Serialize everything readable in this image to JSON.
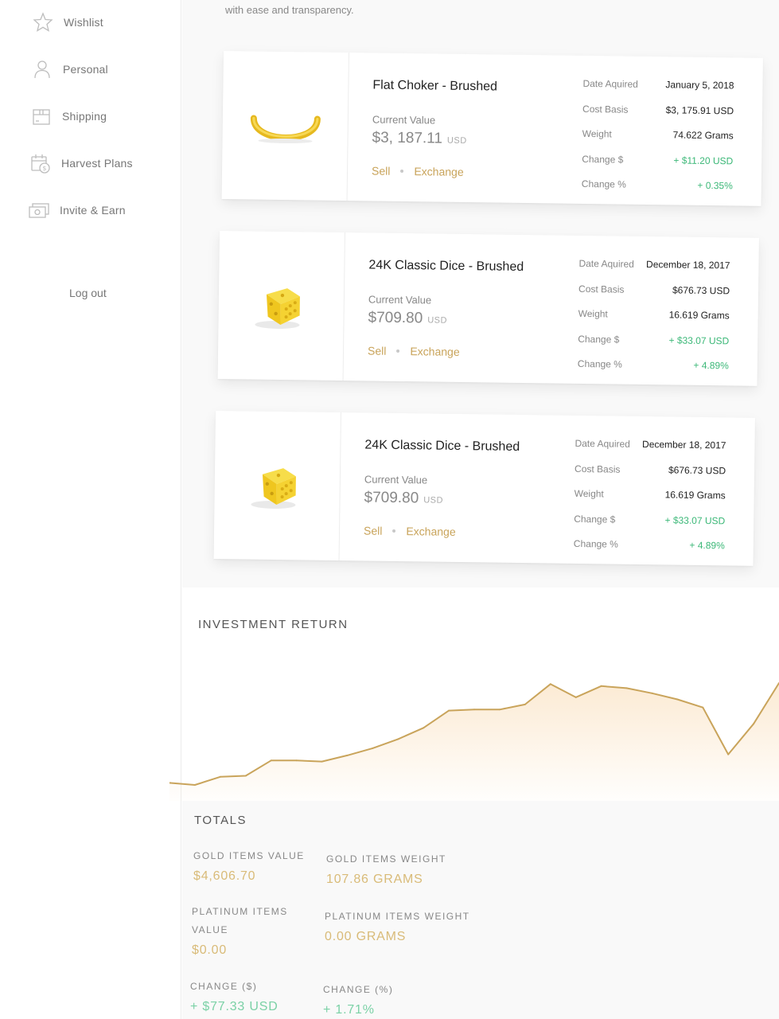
{
  "sidebar": {
    "items": [
      {
        "label": "Wishlist",
        "icon": "star-icon"
      },
      {
        "label": "Personal",
        "icon": "user-icon"
      },
      {
        "label": "Shipping",
        "icon": "package-icon"
      },
      {
        "label": "Harvest Plans",
        "icon": "calendar-dollar-icon"
      },
      {
        "label": "Invite & Earn",
        "icon": "cash-icon"
      }
    ],
    "logout_label": "Log out"
  },
  "intro_text": "with ease and transparency.",
  "holdings": [
    {
      "name": "Flat Choker - Brushed",
      "current_value_label": "Current Value",
      "current_value": "$3, 187.11",
      "currency": "USD",
      "sell_label": "Sell",
      "exchange_label": "Exchange",
      "details": [
        {
          "label": "Date Aquired",
          "value": "January 5, 2018"
        },
        {
          "label": "Cost Basis",
          "value": "$3, 175.91 USD"
        },
        {
          "label": "Weight",
          "value": "74.622 Grams"
        },
        {
          "label": "Change $",
          "value": "+ $11.20 USD"
        },
        {
          "label": "Change %",
          "value": "+ 0.35%"
        }
      ]
    },
    {
      "name": "24K Classic Dice - Brushed",
      "current_value_label": "Current Value",
      "current_value": "$709.80",
      "currency": "USD",
      "sell_label": "Sell",
      "exchange_label": "Exchange",
      "details": [
        {
          "label": "Date Aquired",
          "value": "December 18, 2017"
        },
        {
          "label": "Cost Basis",
          "value": "$676.73 USD"
        },
        {
          "label": "Weight",
          "value": "16.619 Grams"
        },
        {
          "label": "Change $",
          "value": "+ $33.07 USD"
        },
        {
          "label": "Change %",
          "value": "+ 4.89%"
        }
      ]
    },
    {
      "name": "24K Classic Dice - Brushed",
      "current_value_label": "Current Value",
      "current_value": "$709.80",
      "currency": "USD",
      "sell_label": "Sell",
      "exchange_label": "Exchange",
      "details": [
        {
          "label": "Date Aquired",
          "value": "December 18, 2017"
        },
        {
          "label": "Cost Basis",
          "value": "$676.73 USD"
        },
        {
          "label": "Weight",
          "value": "16.619 Grams"
        },
        {
          "label": "Change $",
          "value": "+ $33.07 USD"
        },
        {
          "label": "Change %",
          "value": "+ 4.89%"
        }
      ]
    }
  ],
  "investment_return": {
    "title": "INVESTMENT RETURN"
  },
  "chart_data": {
    "type": "area",
    "title": "INVESTMENT RETURN",
    "xlabel": "",
    "ylabel": "",
    "grid": false,
    "legend": "none",
    "ylim": [
      0,
      100
    ],
    "x": [
      0,
      1,
      2,
      3,
      4,
      5,
      6,
      7,
      8,
      9,
      10,
      11,
      12,
      13,
      14,
      15,
      16,
      17,
      18,
      19,
      20,
      21,
      22,
      23,
      24
    ],
    "values": [
      2,
      0,
      8,
      9,
      24,
      24,
      23,
      29,
      36,
      45,
      56,
      73,
      74,
      74,
      79,
      99,
      86,
      97,
      95,
      90,
      84,
      76,
      30,
      60,
      100
    ],
    "line_color": "#c9a45b",
    "fill_color": "#fbe7cc"
  },
  "totals": {
    "title": "TOTALS",
    "stats": [
      {
        "label": "GOLD ITEMS VALUE",
        "value": "$4,606.70"
      },
      {
        "label": "GOLD ITEMS WEIGHT",
        "value": "107.86 GRAMS"
      },
      {
        "label": "PLATINUM ITEMS VALUE",
        "value": "$0.00"
      },
      {
        "label": "PLATINUM ITEMS WEIGHT",
        "value": "0.00 GRAMS"
      },
      {
        "label": "CHANGE ($)",
        "value": "+ $77.33 USD"
      },
      {
        "label": "CHANGE (%)",
        "value": "+ 1.71%"
      }
    ]
  },
  "colors": {
    "gold_accent": "#c9a45b",
    "positive": "#3cb878",
    "totals_value": "#d9bb78"
  }
}
